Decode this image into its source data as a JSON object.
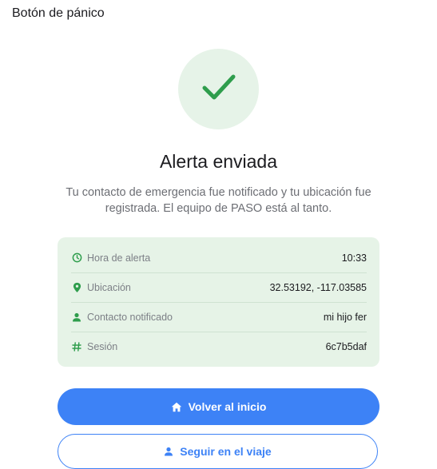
{
  "header": {
    "title": "Botón de pánico"
  },
  "status": {
    "icon": "check-icon",
    "title": "Alerta enviada",
    "message": "Tu contacto de emergencia fue notificado y tu ubicación fue registrada. El equipo de PASO está al tanto."
  },
  "details": [
    {
      "icon": "clock-icon",
      "label": "Hora de alerta",
      "value": "10:33"
    },
    {
      "icon": "location-pin-icon",
      "label": "Ubicación",
      "value": "32.53192, -117.03585"
    },
    {
      "icon": "person-icon",
      "label": "Contacto notificado",
      "value": "mi hijo fer"
    },
    {
      "icon": "hash-icon",
      "label": "Sesión",
      "value": "6c7b5daf"
    }
  ],
  "actions": {
    "primary": {
      "icon": "home-icon",
      "label": "Volver al inicio"
    },
    "secondary": {
      "icon": "person-icon",
      "label": "Seguir en el viaje"
    }
  },
  "colors": {
    "accent": "#3d82f6",
    "success": "#2e9d4c",
    "success_bg": "#e6f3e8"
  }
}
